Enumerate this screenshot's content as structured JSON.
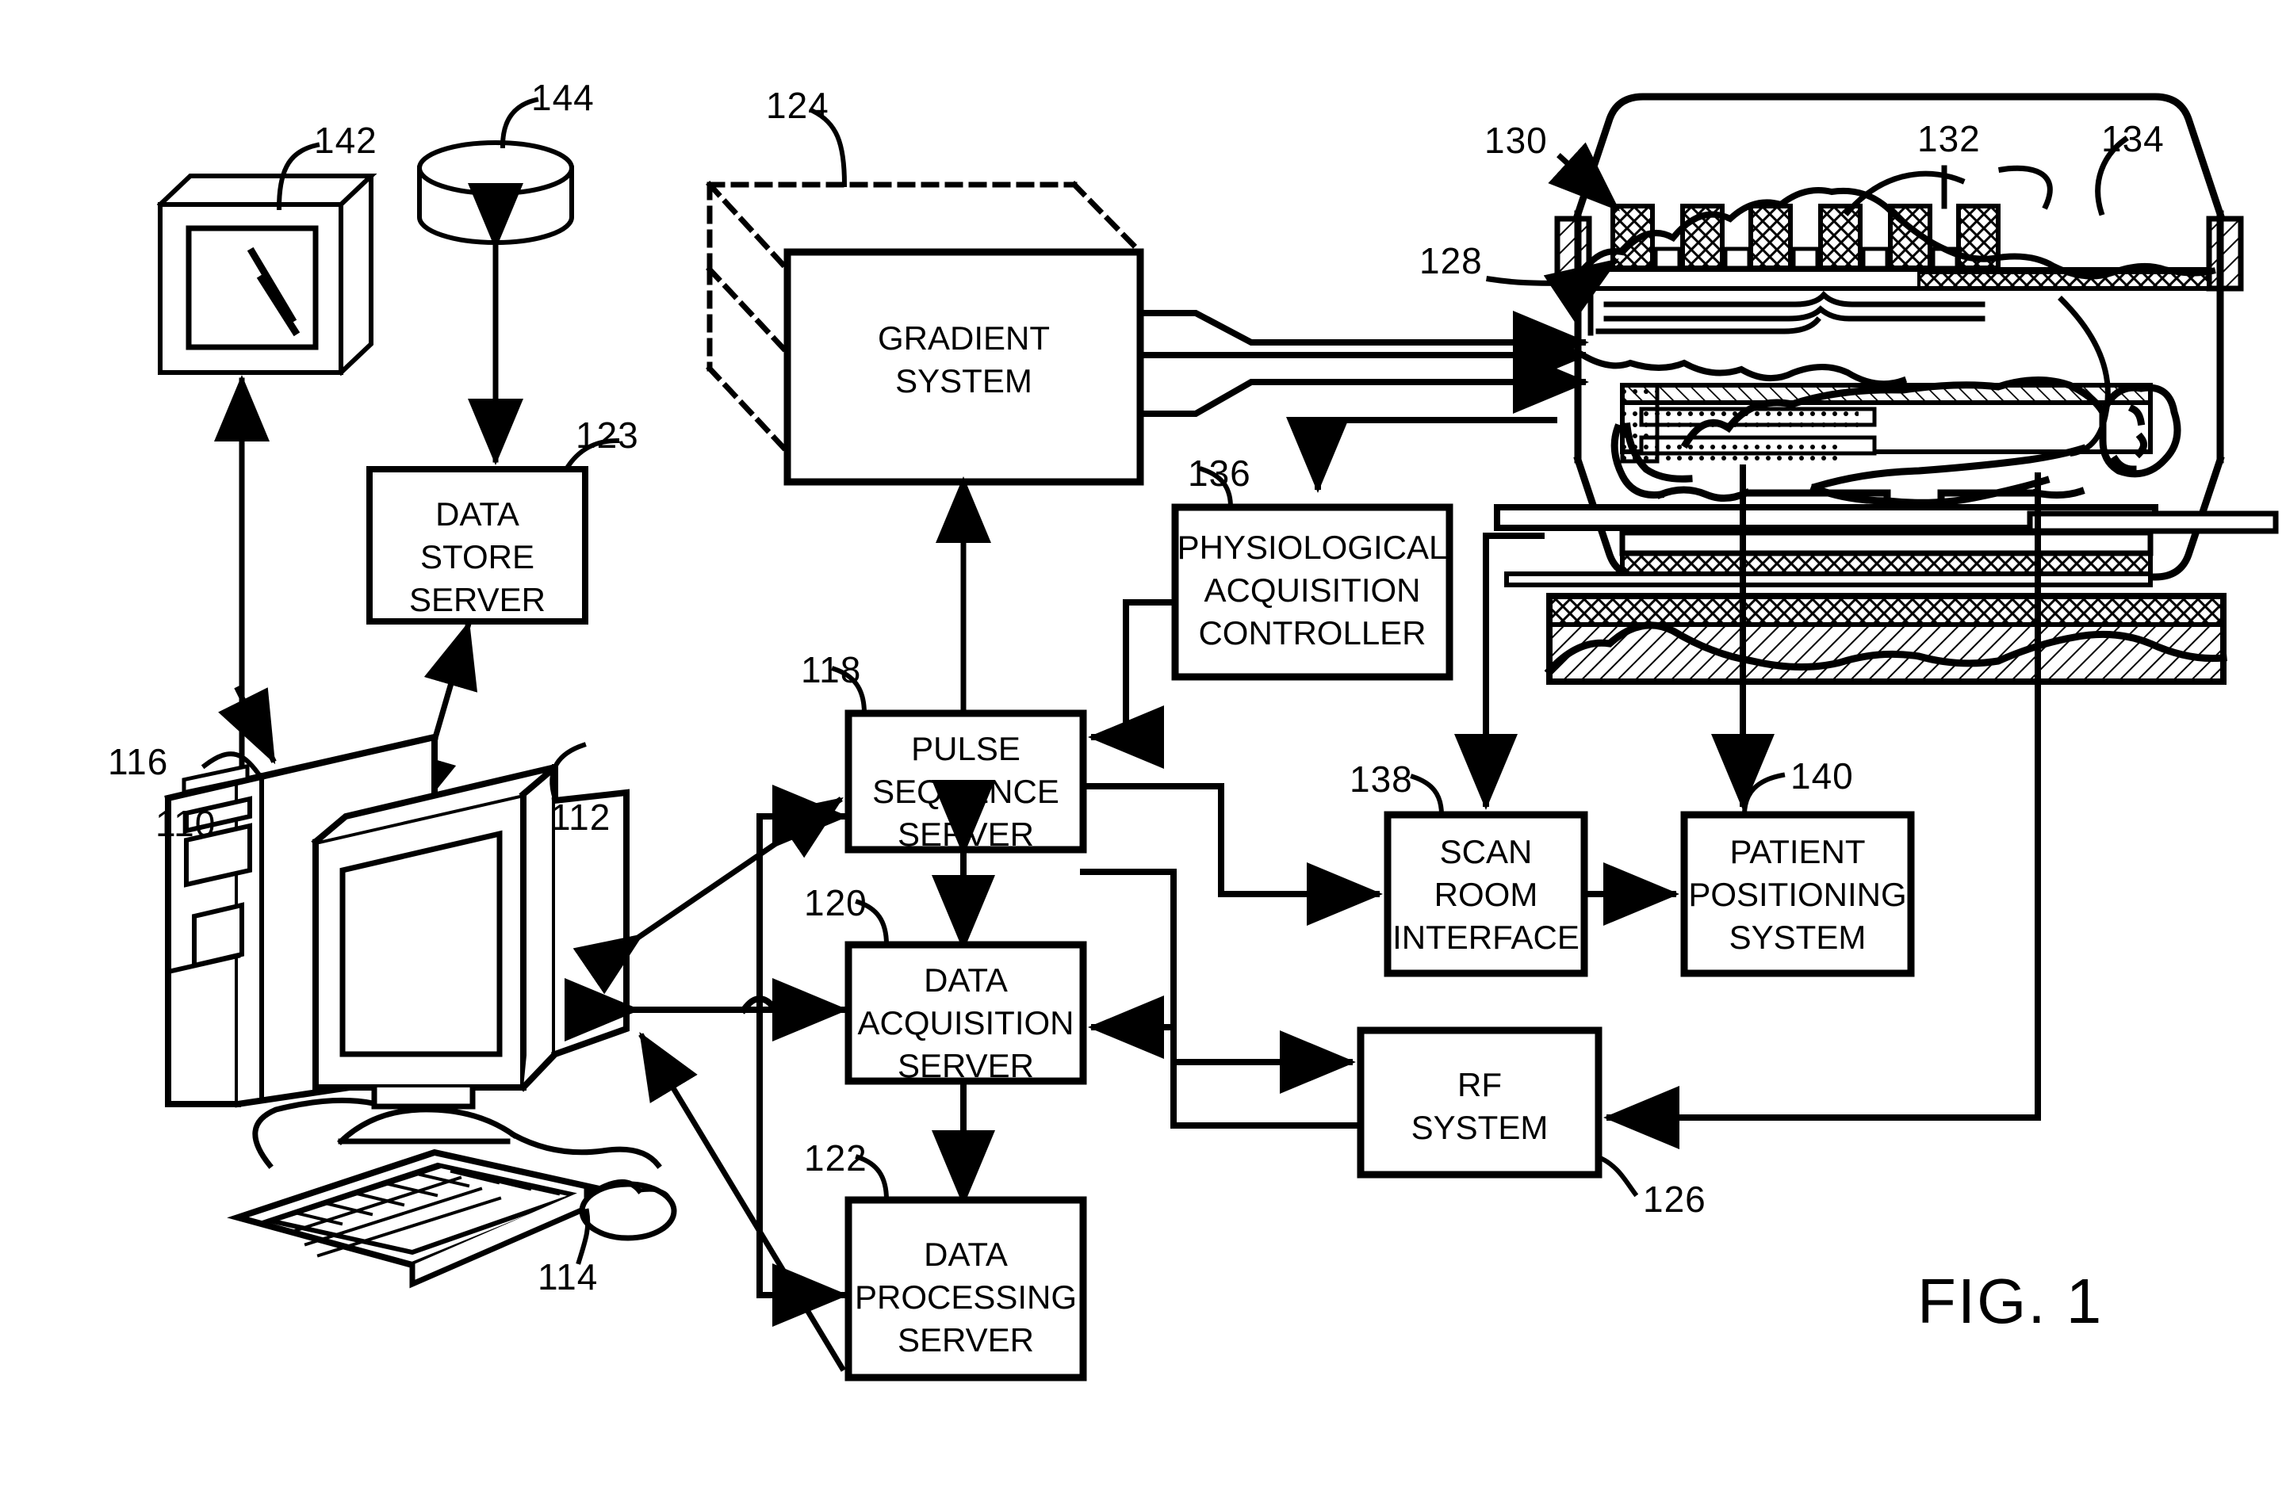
{
  "figure": {
    "caption": "FIG. 1",
    "title_alt": "MRI system block diagram"
  },
  "blocks": [
    {
      "id": "gradient_system",
      "label_lines": [
        "GRADIENT",
        "SYSTEM"
      ],
      "ref": "124"
    },
    {
      "id": "data_store_server",
      "label_lines": [
        "DATA",
        "STORE",
        "SERVER"
      ],
      "ref": "123"
    },
    {
      "id": "pulse_sequence_server",
      "label_lines": [
        "PULSE",
        "SEQUENCE",
        "SERVER"
      ],
      "ref": "118"
    },
    {
      "id": "data_acquisition_server",
      "label_lines": [
        "DATA",
        "ACQUISITION",
        "SERVER"
      ],
      "ref": "120"
    },
    {
      "id": "data_processing_server",
      "label_lines": [
        "DATA",
        "PROCESSING",
        "SERVER"
      ],
      "ref": "122"
    },
    {
      "id": "physiological_acquisition_controller",
      "label_lines": [
        "PHYSIOLOGICAL",
        "ACQUISITION",
        "CONTROLLER"
      ],
      "ref": "136"
    },
    {
      "id": "scan_room_interface",
      "label_lines": [
        "SCAN",
        "ROOM",
        "INTERFACE"
      ],
      "ref": "138"
    },
    {
      "id": "patient_positioning_system",
      "label_lines": [
        "PATIENT",
        "POSITIONING",
        "SYSTEM"
      ],
      "ref": "140"
    },
    {
      "id": "rf_system",
      "label_lines": [
        "RF",
        "SYSTEM"
      ],
      "ref": "126"
    }
  ],
  "reference_numerals": [
    {
      "num": "110",
      "target": "operator-workstation"
    },
    {
      "num": "112",
      "target": "display-monitor"
    },
    {
      "num": "114",
      "target": "keyboard-and-mouse"
    },
    {
      "num": "116",
      "target": "processor-tower"
    },
    {
      "num": "118",
      "target": "pulse-sequence-server"
    },
    {
      "num": "120",
      "target": "data-acquisition-server"
    },
    {
      "num": "122",
      "target": "data-processing-server"
    },
    {
      "num": "123",
      "target": "data-store-server"
    },
    {
      "num": "124",
      "target": "gradient-system"
    },
    {
      "num": "126",
      "target": "rf-system"
    },
    {
      "num": "128",
      "target": "rf-coil"
    },
    {
      "num": "130",
      "target": "magnet-assembly"
    },
    {
      "num": "132",
      "target": "gradient-coil"
    },
    {
      "num": "134",
      "target": "polarizing-magnet"
    },
    {
      "num": "136",
      "target": "physiological-acquisition-controller"
    },
    {
      "num": "138",
      "target": "scan-room-interface"
    },
    {
      "num": "140",
      "target": "patient-positioning-system"
    },
    {
      "num": "142",
      "target": "networked-display"
    },
    {
      "num": "144",
      "target": "networked-data-store"
    }
  ],
  "colors": {
    "line": "#000000",
    "background": "#ffffff"
  }
}
